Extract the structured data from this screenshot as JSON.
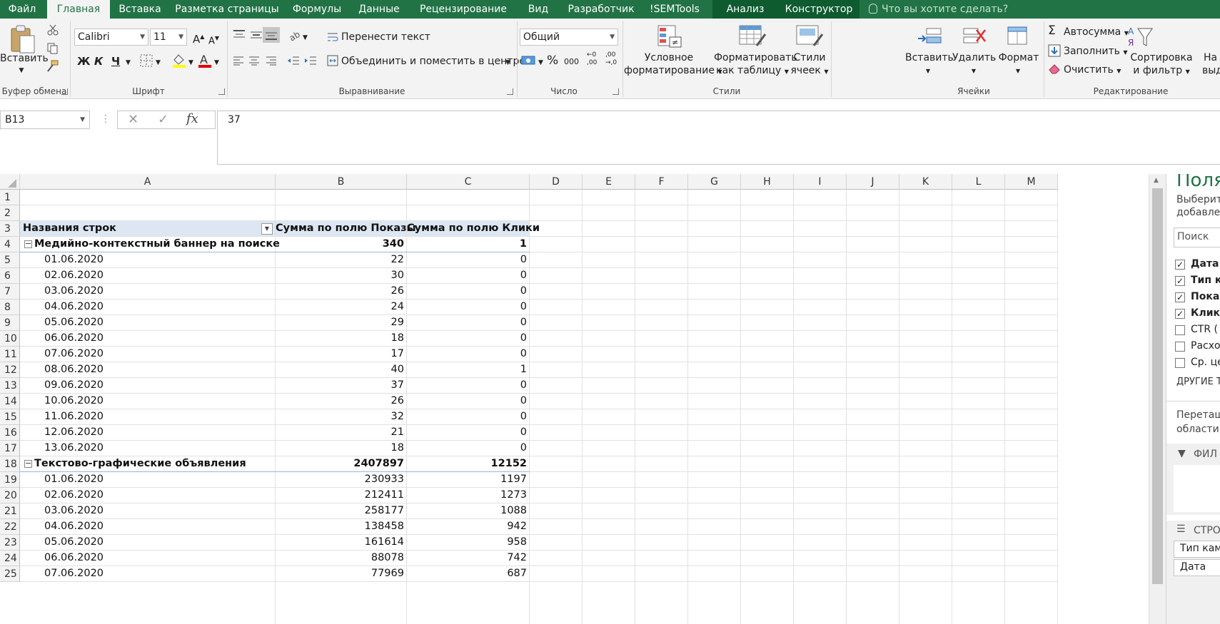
{
  "tabs": [
    "Файл",
    "Главная",
    "Вставка",
    "Разметка страницы",
    "Формулы",
    "Данные",
    "Рецензирование",
    "Вид",
    "Разработчик",
    "!SEMTools",
    "Анализ",
    "Конструктор"
  ],
  "tell_me": "Что вы хотите сделать?",
  "ribbon": {
    "clipboard": {
      "paste": "Вставить",
      "group": "Буфер обмена"
    },
    "font": {
      "name": "Calibri",
      "size": "11",
      "bold": "Ж",
      "italic": "К",
      "underline": "Ч",
      "group": "Шрифт"
    },
    "alignment": {
      "wrap": "Перенести текст",
      "merge": "Объединить и поместить в центре",
      "group": "Выравнивание"
    },
    "number": {
      "format": "Общий",
      "group": "Число"
    },
    "styles": {
      "conditional_1": "Условное",
      "conditional_2": "форматирование",
      "as_table_1": "Форматировать",
      "as_table_2": "как таблицу",
      "cell_styles_1": "Стили",
      "cell_styles_2": "ячеек",
      "group": "Стили"
    },
    "cells": {
      "insert": "Вставить",
      "delete": "Удалить",
      "format": "Формат",
      "group": "Ячейки"
    },
    "editing": {
      "autosum": "Автосумма",
      "fill": "Заполнить",
      "clear": "Очистить",
      "sort_1": "Сортировка",
      "sort_2": "и фильтр",
      "find_1": "На",
      "find_2": "выде",
      "group": "Редактирование"
    }
  },
  "formula_bar": {
    "name_box": "B13",
    "formula": "37",
    "fx": "fx"
  },
  "columns": [
    "A",
    "B",
    "C",
    "D",
    "E",
    "F",
    "G",
    "H",
    "I",
    "J",
    "K",
    "L",
    "M"
  ],
  "rows": [
    "1",
    "2",
    "3",
    "4",
    "5",
    "6",
    "7",
    "8",
    "9",
    "10",
    "11",
    "12",
    "13",
    "14",
    "15",
    "16",
    "17",
    "18",
    "19",
    "20",
    "21",
    "22",
    "23",
    "24",
    "25"
  ],
  "pivot": {
    "header": {
      "a": "Названия строк",
      "b": "Сумма по полю Показы",
      "c": "Сумма по полю Клики"
    },
    "groups": [
      {
        "label": "Медийно-контекстный баннер на поиске",
        "b": "340",
        "c": "1",
        "items": [
          [
            "01.06.2020",
            "22",
            "0"
          ],
          [
            "02.06.2020",
            "30",
            "0"
          ],
          [
            "03.06.2020",
            "26",
            "0"
          ],
          [
            "04.06.2020",
            "24",
            "0"
          ],
          [
            "05.06.2020",
            "29",
            "0"
          ],
          [
            "06.06.2020",
            "18",
            "0"
          ],
          [
            "07.06.2020",
            "17",
            "0"
          ],
          [
            "08.06.2020",
            "40",
            "1"
          ],
          [
            "09.06.2020",
            "37",
            "0"
          ],
          [
            "10.06.2020",
            "26",
            "0"
          ],
          [
            "11.06.2020",
            "32",
            "0"
          ],
          [
            "12.06.2020",
            "21",
            "0"
          ],
          [
            "13.06.2020",
            "18",
            "0"
          ]
        ]
      },
      {
        "label": "Текстово-графические объявления",
        "b": "2407897",
        "c": "12152",
        "items": [
          [
            "01.06.2020",
            "230933",
            "1197"
          ],
          [
            "02.06.2020",
            "212411",
            "1273"
          ],
          [
            "03.06.2020",
            "258177",
            "1088"
          ],
          [
            "04.06.2020",
            "138458",
            "942"
          ],
          [
            "05.06.2020",
            "161614",
            "958"
          ],
          [
            "06.06.2020",
            "88078",
            "742"
          ],
          [
            "07.06.2020",
            "77969",
            "687"
          ]
        ]
      }
    ]
  },
  "field_pane": {
    "title": "Поля",
    "subtitle_1": "Выберит",
    "subtitle_2": "добавле",
    "search": "Поиск",
    "fields": [
      {
        "label": "Дата",
        "checked": true
      },
      {
        "label": "Тип к",
        "checked": true
      },
      {
        "label": "Показ",
        "checked": true
      },
      {
        "label": "Клик",
        "checked": true
      },
      {
        "label": "CTR (",
        "checked": false
      },
      {
        "label": "Расхо",
        "checked": false
      },
      {
        "label": "Ср. це",
        "checked": false
      }
    ],
    "other": "ДРУГИЕ Т",
    "drag_1": "Перетащ",
    "drag_2": "области:",
    "filters": "ФИЛ",
    "rows": "СТРО",
    "rows_items": [
      "Тип кам",
      "Дата"
    ]
  },
  "colors": {
    "accent": "#217346",
    "pivot_header": "#dde7f3"
  }
}
